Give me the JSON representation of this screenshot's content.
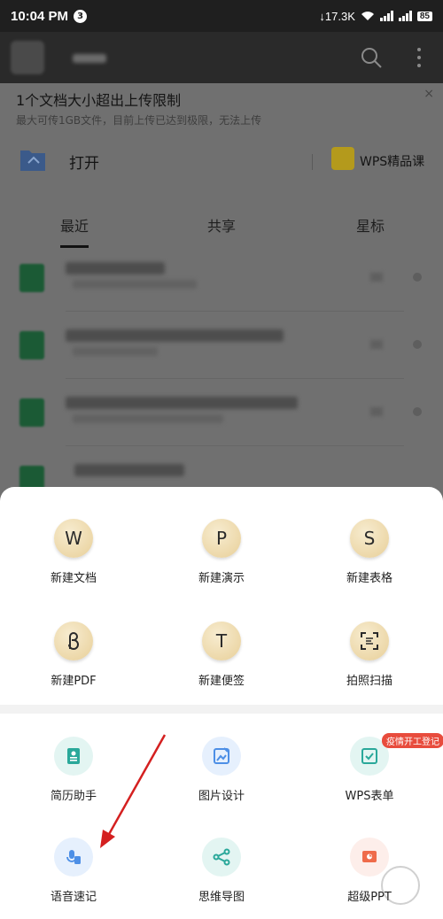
{
  "status_bar": {
    "time": "10:04 PM",
    "notif_count": "3",
    "net_speed": "↓17.3K",
    "battery": "85"
  },
  "banner": {
    "title": "1个文档大小超出上传限制",
    "subtitle": "最大可传1GB文件，目前上传已达到极限，无法上传",
    "close": "×"
  },
  "open_row": {
    "open_label": "打开",
    "course_label": "WPS精品课"
  },
  "tabs": [
    {
      "label": "最近"
    },
    {
      "label": "共享"
    },
    {
      "label": "星标"
    }
  ],
  "create_grid": [
    {
      "label": "新建文档",
      "icon": "word-doc-icon",
      "glyph": "W"
    },
    {
      "label": "新建演示",
      "icon": "presentation-icon",
      "glyph": "P"
    },
    {
      "label": "新建表格",
      "icon": "spreadsheet-icon",
      "glyph": "S"
    },
    {
      "label": "新建PDF",
      "icon": "pdf-icon",
      "glyph": ""
    },
    {
      "label": "新建便签",
      "icon": "note-icon",
      "glyph": "T"
    },
    {
      "label": "拍照扫描",
      "icon": "scan-icon",
      "glyph": ""
    }
  ],
  "tools_grid": [
    {
      "label": "简历助手",
      "icon": "resume-icon"
    },
    {
      "label": "图片设计",
      "icon": "image-design-icon"
    },
    {
      "label": "WPS表单",
      "icon": "form-icon",
      "badge": "疫情开工登记"
    },
    {
      "label": "语音速记",
      "icon": "voice-note-icon"
    },
    {
      "label": "思维导图",
      "icon": "mindmap-icon"
    },
    {
      "label": "超级PPT",
      "icon": "super-ppt-icon"
    }
  ],
  "colors": {
    "gold": "#e8cf98",
    "teal": "#2aa89a",
    "blue": "#4d8fe6",
    "red_badge": "#e84c3d",
    "arrow": "#d42020"
  }
}
